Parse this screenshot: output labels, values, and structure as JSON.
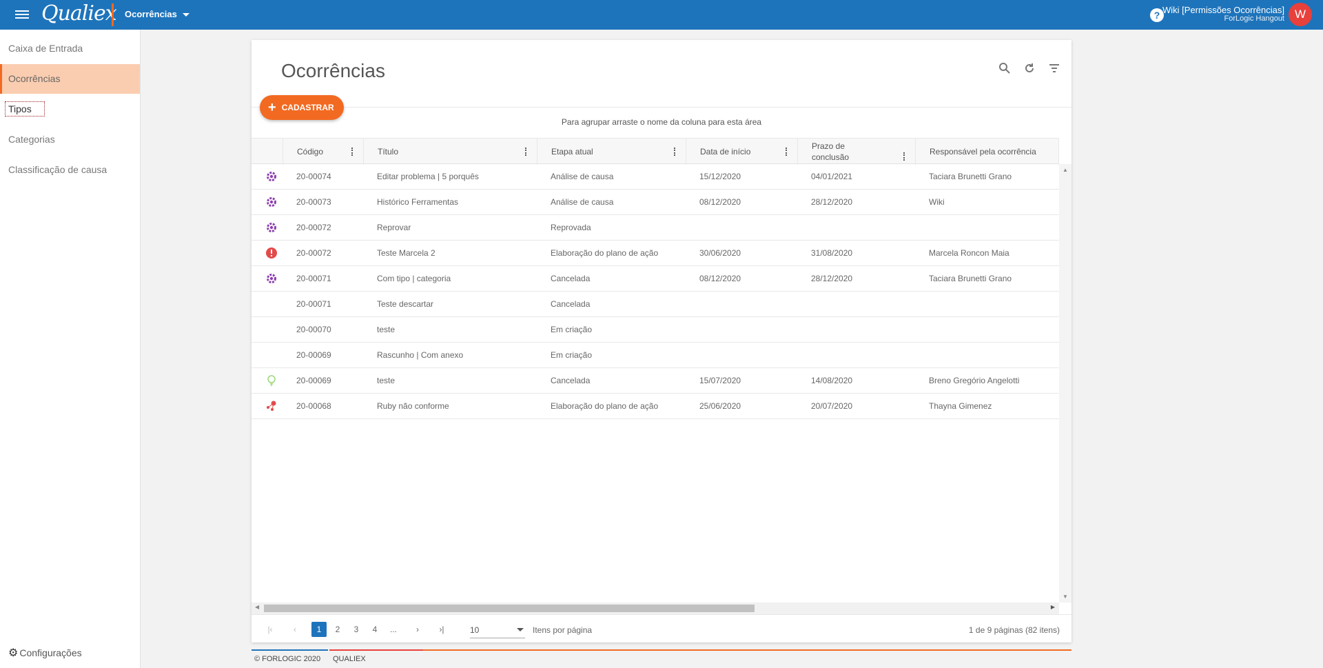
{
  "topbar": {
    "logo": "Qualiex",
    "module": "Ocorrências",
    "help": "?",
    "user_name": "Wiki [Permissões Ocorrências]",
    "user_org": "ForLogic Hangout",
    "avatar_initial": "W"
  },
  "sidebar": {
    "items": [
      {
        "label": "Caixa de Entrada"
      },
      {
        "label": "Ocorrências"
      },
      {
        "label": "Tipos"
      },
      {
        "label": "Categorias"
      },
      {
        "label": "Classificação de causa"
      }
    ],
    "settings_label": "Configurações"
  },
  "page": {
    "title": "Ocorrências",
    "add_button": "CADASTRAR",
    "group_hint": "Para agrupar arraste o nome da coluna para esta área"
  },
  "grid": {
    "columns": [
      "Código",
      "Título",
      "Etapa atual",
      "Data de início",
      "Prazo de conclusão",
      "Responsável pela ocorrência"
    ],
    "rows": [
      {
        "icon": "gear-icon",
        "code": "20-00074",
        "title": "Editar problema | 5 porquês",
        "stage": "Análise de causa",
        "start": "15/12/2020",
        "due": "04/01/2021",
        "owner": "Taciara Brunetti Grano"
      },
      {
        "icon": "gear-icon",
        "code": "20-00073",
        "title": "Histórico Ferramentas",
        "stage": "Análise de causa",
        "start": "08/12/2020",
        "due": "28/12/2020",
        "owner": "Wiki"
      },
      {
        "icon": "gear-icon",
        "code": "20-00072",
        "title": "Reprovar",
        "stage": "Reprovada",
        "start": "",
        "due": "",
        "owner": ""
      },
      {
        "icon": "alert-icon",
        "code": "20-00072",
        "title": "Teste Marcela 2",
        "stage": "Elaboração do plano de ação",
        "start": "30/06/2020",
        "due": "31/08/2020",
        "owner": "Marcela Roncon Maia"
      },
      {
        "icon": "gear-icon",
        "code": "20-00071",
        "title": "Com tipo | categoria",
        "stage": "Cancelada",
        "start": "08/12/2020",
        "due": "28/12/2020",
        "owner": "Taciara Brunetti Grano"
      },
      {
        "icon": "",
        "code": "20-00071",
        "title": "Teste descartar",
        "stage": "Cancelada",
        "start": "",
        "due": "",
        "owner": ""
      },
      {
        "icon": "",
        "code": "20-00070",
        "title": "teste",
        "stage": "Em criação",
        "start": "",
        "due": "",
        "owner": ""
      },
      {
        "icon": "",
        "code": "20-00069",
        "title": "Rascunho | Com anexo",
        "stage": "Em criação",
        "start": "",
        "due": "",
        "owner": ""
      },
      {
        "icon": "lightbulb-icon",
        "code": "20-00069",
        "title": "teste",
        "stage": "Cancelada",
        "start": "15/07/2020",
        "due": "14/08/2020",
        "owner": "Breno Gregório Angelotti"
      },
      {
        "icon": "molecule-icon",
        "code": "20-00068",
        "title": "Ruby não conforme",
        "stage": "Elaboração do plano de ação",
        "start": "25/06/2020",
        "due": "20/07/2020",
        "owner": "Thayna Gimenez"
      }
    ]
  },
  "pager": {
    "pages": [
      "1",
      "2",
      "3",
      "4",
      "..."
    ],
    "current_page": "1",
    "page_size": "10",
    "page_size_label": "Itens por página",
    "info": "1 de 9 páginas (82 itens)"
  },
  "footer": {
    "copyright": "© FORLOGIC 2020",
    "brand": "QUALIEX"
  },
  "colors": {
    "primary": "#1e74bb",
    "accent": "#f26a21",
    "gear_icon": "#8e3fb0",
    "alert_icon": "#e34b4b",
    "bulb_icon": "#9ad67a"
  }
}
